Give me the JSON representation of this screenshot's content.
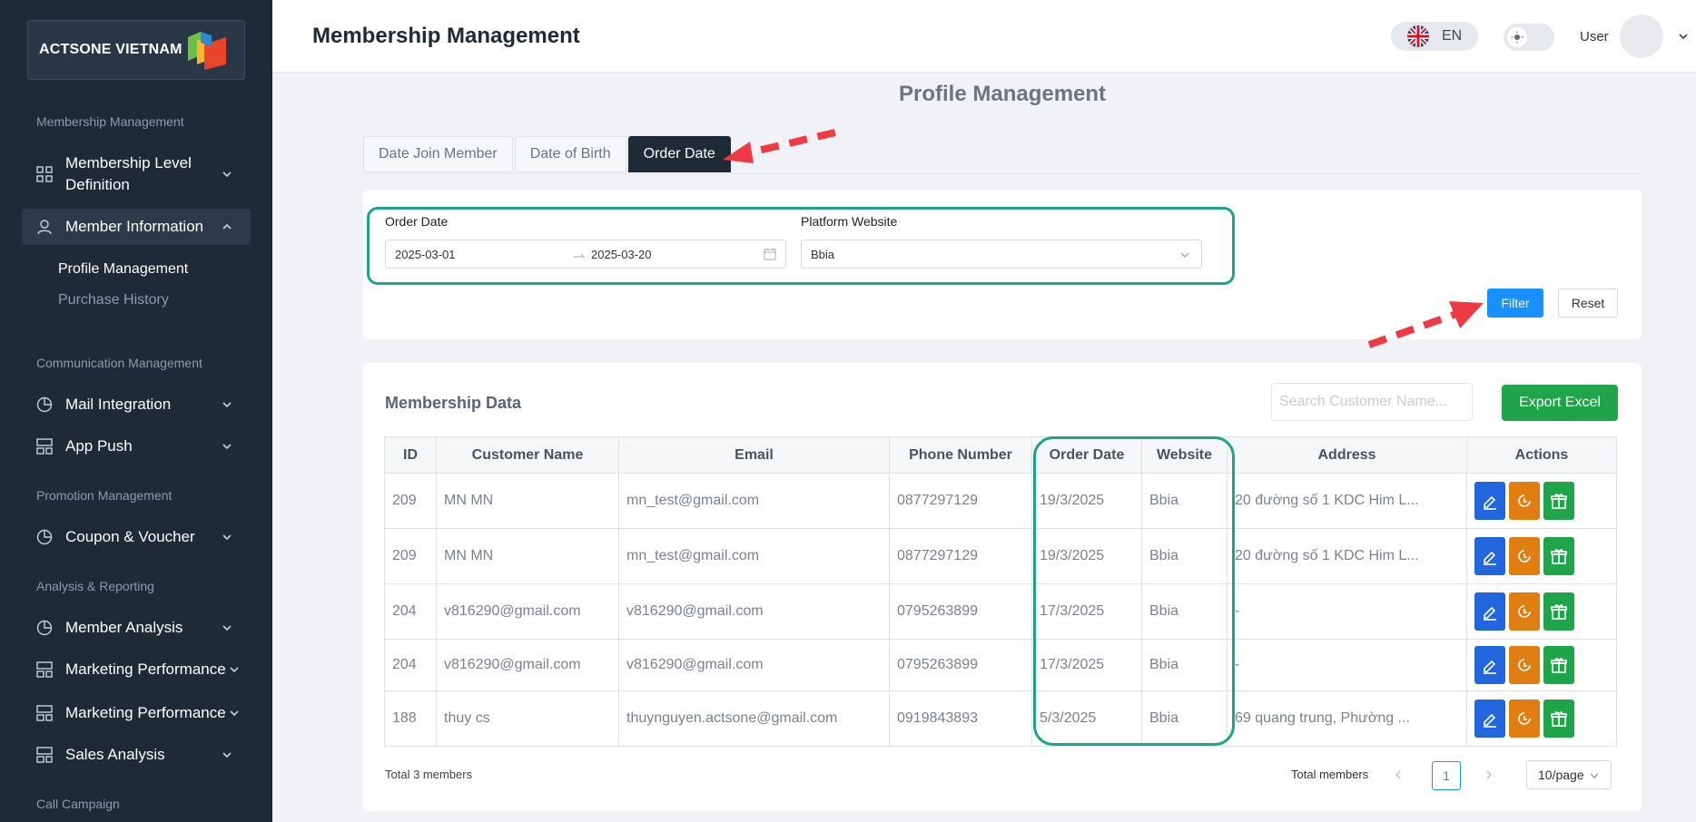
{
  "sidebar": {
    "brand": "ACTSONE VIETNAM",
    "sections": [
      "Membership Management",
      "Communication Management",
      "Promotion Management",
      "Analysis & Reporting",
      "Call Campaign"
    ],
    "items": [
      {
        "label": "Membership Level Definition",
        "icon": "grid-icon"
      },
      {
        "label": "Member Information",
        "icon": "user-icon"
      },
      {
        "label": "Mail Integration",
        "icon": "pie-icon"
      },
      {
        "label": "App Push",
        "icon": "layout-icon"
      },
      {
        "label": "Coupon & Voucher",
        "icon": "pie-icon"
      },
      {
        "label": "Member Analysis",
        "icon": "pie-icon"
      },
      {
        "label": "Marketing Performance",
        "icon": "layout-icon"
      },
      {
        "label": "Marketing Performance",
        "icon": "layout-icon"
      },
      {
        "label": "Sales Analysis",
        "icon": "layout-icon"
      }
    ],
    "subitems": [
      "Profile Management",
      "Purchase History"
    ]
  },
  "header": {
    "title": "Membership Management",
    "lang": "EN",
    "user": "User"
  },
  "page": {
    "heading": "Profile Management",
    "tabs": [
      "Date Join Member",
      "Date of Birth",
      "Order Date"
    ]
  },
  "filter": {
    "order_date_label": "Order Date",
    "date_from": "2025-03-01",
    "date_to": "2025-03-20",
    "platform_label": "Platform Website",
    "platform_value": "Bbia",
    "filter_label": "Filter",
    "reset_label": "Reset"
  },
  "data": {
    "title": "Membership Data",
    "search_placeholder": "Search Customer Name...",
    "export_label": "Export Excel",
    "columns": [
      "ID",
      "Customer Name",
      "Email",
      "Phone Number",
      "Order Date",
      "Website",
      "Address",
      "Actions"
    ],
    "rows": [
      [
        "209",
        "MN MN",
        "mn_test@gmail.com",
        "0877297129",
        "19/3/2025",
        "Bbia",
        "20 đường số 1 KDC Him L..."
      ],
      [
        "209",
        "MN MN",
        "mn_test@gmail.com",
        "0877297129",
        "19/3/2025",
        "Bbia",
        "20 đường số 1 KDC Him L..."
      ],
      [
        "204",
        "v816290@gmail.com",
        "v816290@gmail.com",
        "0795263899",
        "17/3/2025",
        "Bbia",
        "-"
      ],
      [
        "204",
        "v816290@gmail.com",
        "v816290@gmail.com",
        "0795263899",
        "17/3/2025",
        "Bbia",
        "-"
      ],
      [
        "188",
        "thuy cs",
        "thuynguyen.actsone@gmail.com",
        "0919843893",
        "5/3/2025",
        "Bbia",
        "69 quang trung, Phường ..."
      ]
    ],
    "total": "Total 3 members",
    "total_members_label": "Total members",
    "page": "1",
    "page_size": "10/page"
  },
  "colors": {
    "sidebar": "#1f2a37",
    "primary": "#1890ff",
    "export": "#1ea54a",
    "highlight": "#1aa58a",
    "annotation_arrow": "#ee3a44"
  }
}
